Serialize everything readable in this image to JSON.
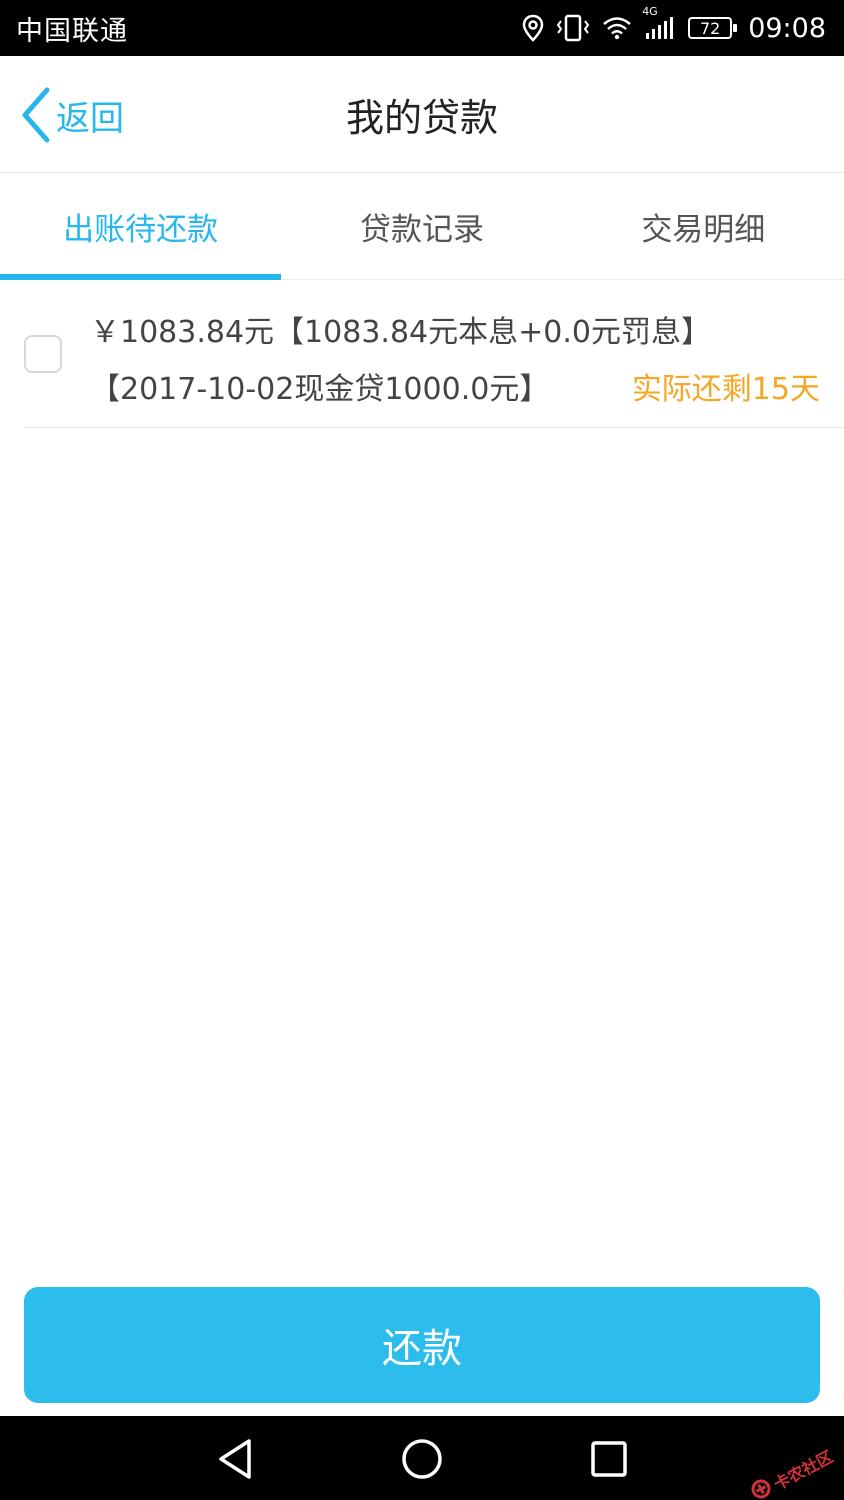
{
  "status_bar": {
    "carrier": "中国联通",
    "network": "4G",
    "battery": "72",
    "time": "09:08"
  },
  "nav": {
    "back_label": "返回",
    "title": "我的贷款"
  },
  "tabs": [
    {
      "label": "出账待还款",
      "active": true
    },
    {
      "label": "贷款记录",
      "active": false
    },
    {
      "label": "交易明细",
      "active": false
    }
  ],
  "loan_items": [
    {
      "line1": "￥1083.84元【1083.84元本息+0.0元罚息】",
      "line2": "【2017-10-02现金贷1000.0元】",
      "remaining": "实际还剩15天",
      "checked": false
    }
  ],
  "repay_button": {
    "label": "还款"
  },
  "watermark": {
    "text": "卡农社区"
  },
  "colors": {
    "accent": "#27b7ee",
    "button": "#2cbdec",
    "warning": "#f5a623"
  }
}
